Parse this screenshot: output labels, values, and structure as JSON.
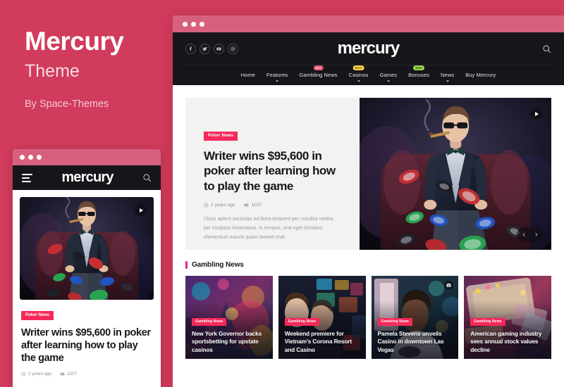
{
  "promo": {
    "title": "Mercury",
    "subtitle": "Theme",
    "author": "By Space-Themes"
  },
  "site": {
    "logo": "mercury",
    "search_icon": "search-icon"
  },
  "socials": [
    {
      "name": "facebook-icon",
      "label": "Facebook"
    },
    {
      "name": "twitter-icon",
      "label": "Twitter"
    },
    {
      "name": "youtube-icon",
      "label": "YouTube"
    },
    {
      "name": "dribbble-icon",
      "label": "Dribbble"
    }
  ],
  "nav": [
    {
      "label": "Home",
      "badge": null,
      "badge_class": "",
      "caret": false
    },
    {
      "label": "Features",
      "badge": null,
      "badge_class": "",
      "caret": true
    },
    {
      "label": "Gambling News",
      "badge": "Hot",
      "badge_class": "badge-hot",
      "caret": false
    },
    {
      "label": "Casinos",
      "badge": "Best",
      "badge_class": "badge-best",
      "caret": true
    },
    {
      "label": "Games",
      "badge": null,
      "badge_class": "",
      "caret": true
    },
    {
      "label": "Bonuses",
      "badge": "New",
      "badge_class": "badge-new",
      "caret": false
    },
    {
      "label": "News",
      "badge": null,
      "badge_class": "",
      "caret": true
    },
    {
      "label": "Buy Mercury",
      "badge": null,
      "badge_class": "",
      "caret": false
    }
  ],
  "hero": {
    "category": "Poker News",
    "title": "Writer wins $95,600 in poker after learning how to play the game",
    "time": "2 years ago",
    "views": "1107",
    "excerpt": "Class aptent sociosqu ad litora torquent per conubia nostra, per inceptos himenaeos. In tempus, erat eget tincidunt elementum mauris quam laoreet erat.",
    "play_icon": "play-icon",
    "prev_icon": "chevron-left-icon",
    "next_icon": "chevron-right-icon"
  },
  "section": {
    "title": "Gambling News",
    "marker_color": "#e6219b"
  },
  "cards": [
    {
      "badge": "Gambling News",
      "title": "New York Governor backs sportsbetting for upstate casinos",
      "has_camera": false
    },
    {
      "badge": "Gambling News",
      "title": "Weekend premiere for Vietnam's Corona Resort and Casino",
      "has_camera": false
    },
    {
      "badge": "Gambling News",
      "title": "Pamela Stevens unveils Casino in downtown Las Vegas",
      "has_camera": true
    },
    {
      "badge": "Gambling News",
      "title": "American gaming industry sees annual stock values decline",
      "has_camera": false
    }
  ],
  "mobile": {
    "menu_icon": "hamburger-menu-icon",
    "logo": "mercury",
    "search_icon": "search-icon"
  },
  "colors": {
    "brand_pink": "#d13b5c",
    "accent_red": "#f6295a",
    "dark_header": "#16161a",
    "section_marker": "#e6219b"
  }
}
